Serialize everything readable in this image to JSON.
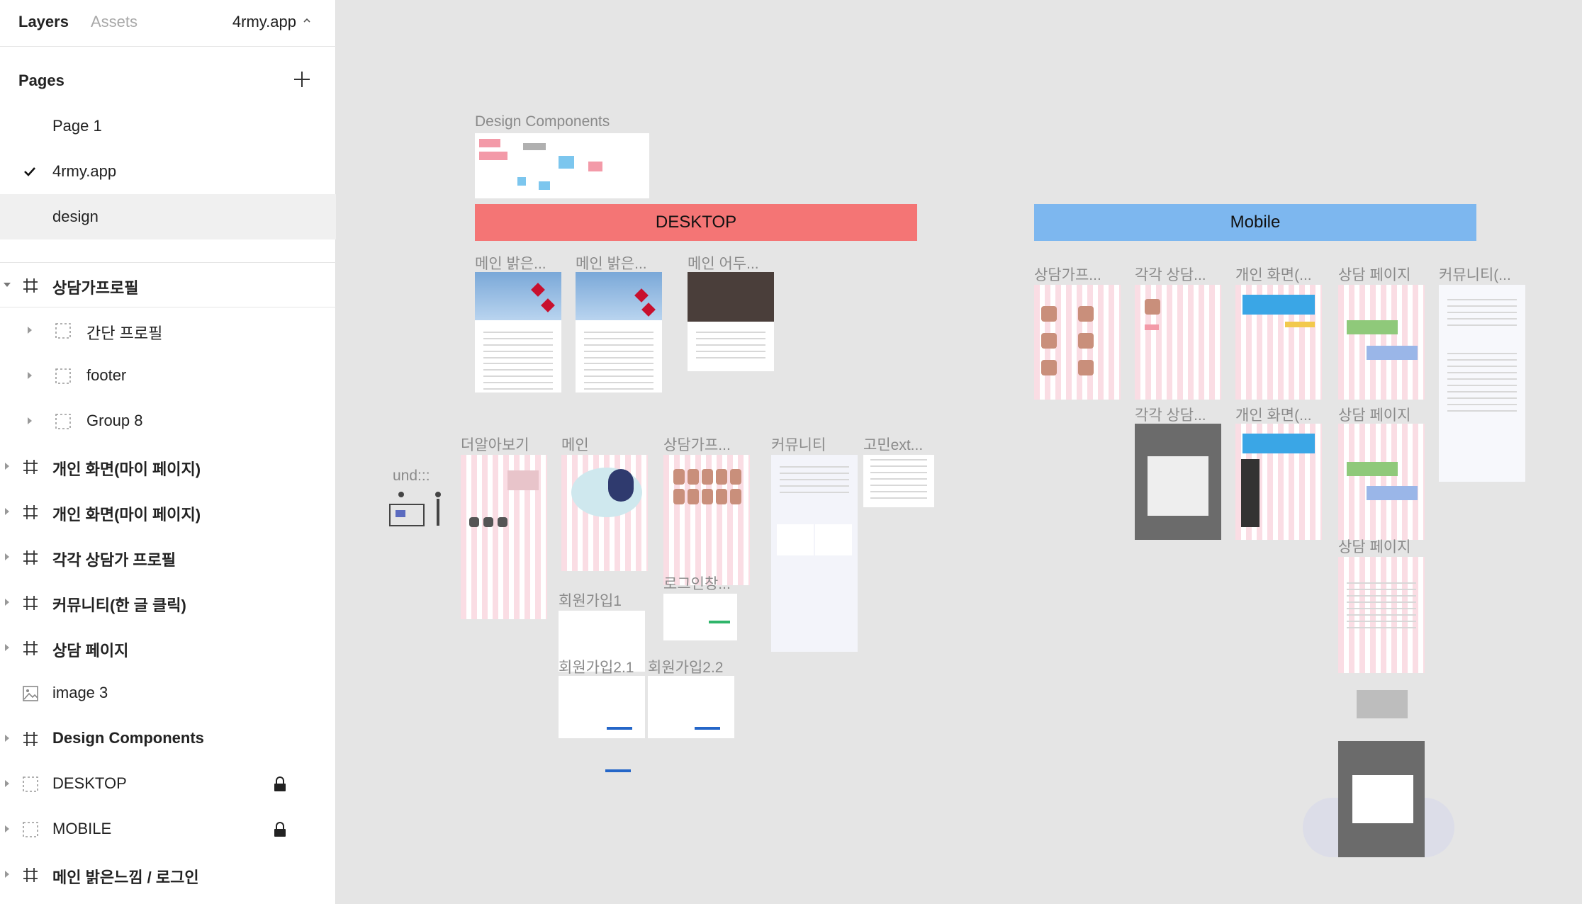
{
  "panel": {
    "tabs": {
      "layers": "Layers",
      "assets": "Assets"
    },
    "file_name": "4rmy.app",
    "pages_heading": "Pages",
    "pages": [
      {
        "label": "Page 1"
      },
      {
        "label": "4rmy.app"
      },
      {
        "label": "design"
      }
    ],
    "layers": [
      {
        "label": "상담가프로필",
        "type": "frame"
      },
      {
        "label": "간단 프로필",
        "type": "group"
      },
      {
        "label": "footer",
        "type": "group"
      },
      {
        "label": "Group 8",
        "type": "group"
      },
      {
        "label": "개인 화면(마이 페이지)",
        "type": "frame"
      },
      {
        "label": "개인 화면(마이 페이지)",
        "type": "frame"
      },
      {
        "label": "각각 상담가 프로필",
        "type": "frame"
      },
      {
        "label": "커뮤니티(한 글 클릭)",
        "type": "frame"
      },
      {
        "label": "상담 페이지",
        "type": "frame"
      },
      {
        "label": "image 3",
        "type": "image"
      },
      {
        "label": "Design Components",
        "type": "frame"
      },
      {
        "label": "DESKTOP",
        "type": "group"
      },
      {
        "label": "MOBILE",
        "type": "group"
      },
      {
        "label": "메인 밝은느낌 / 로그인",
        "type": "frame"
      }
    ]
  },
  "canvas": {
    "design_components": "Design Components",
    "desktop_banner": "DESKTOP",
    "mobile_banner": "Mobile",
    "desktop_frames": [
      "메인 밝은...",
      "메인 밝은...",
      "메인 어두..."
    ],
    "desktop_row2": [
      "더알아보기",
      "메인",
      "상담가프...",
      "커뮤니티",
      "고민ext..."
    ],
    "undraw_label": "und:::",
    "login_label": "로그인창...",
    "signup": [
      "회원가입1",
      "회원가입2.1",
      "회원가입2.2"
    ],
    "mobile_row1": [
      "상담가프...",
      "각각 상담...",
      "개인 화면(...",
      "상담 페이지",
      "커뮤니티(..."
    ],
    "mobile_row2": [
      "각각 상담...",
      "개인 화면(...",
      "상담 페이지"
    ],
    "mobile_row3": "상담 페이지"
  },
  "colors": {
    "desktop_banner": "#f47575",
    "mobile_banner": "#7db7ef",
    "selected_page_bg": "#f0f0f0"
  }
}
